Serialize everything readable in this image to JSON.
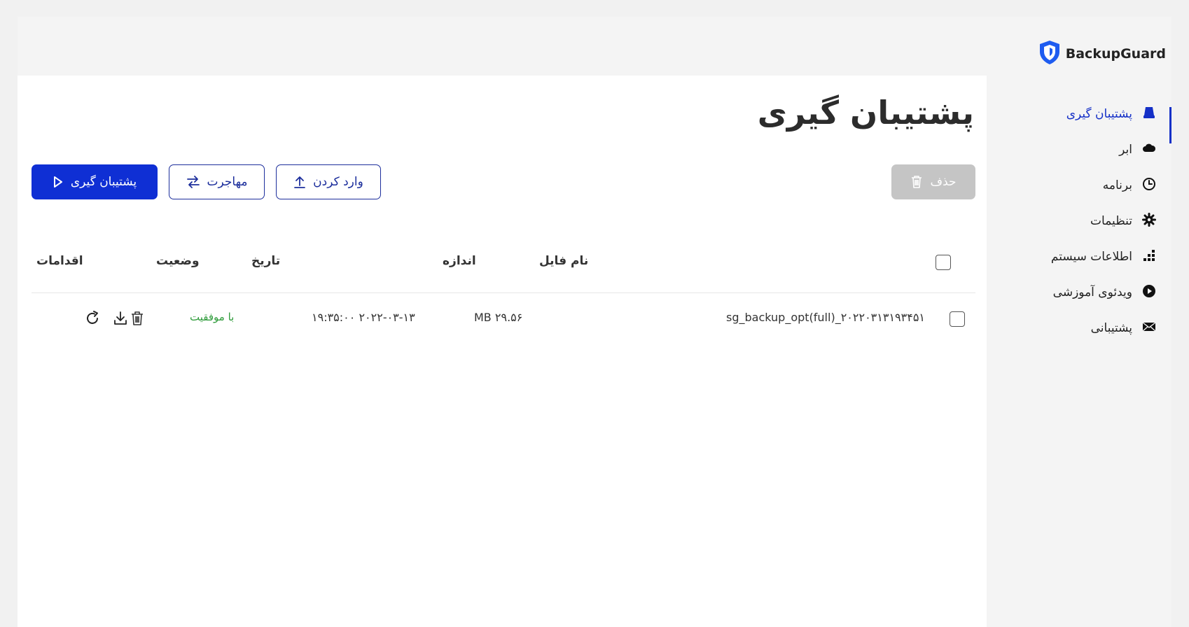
{
  "app": {
    "logo_text": "BackupGuard"
  },
  "page": {
    "title": "پشتیبان گیری"
  },
  "toolbar": {
    "backup_label": "پشتیبان گیری",
    "migrate_label": "مهاجرت",
    "import_label": "وارد کردن",
    "delete_label": "حذف"
  },
  "table": {
    "headers": {
      "filename": "نام فایل",
      "size": "اندازه",
      "date": "تاریخ",
      "status": "وضعیت",
      "actions": "اقدامات"
    },
    "rows": [
      {
        "filename": "sg_backup_opt(full)_۲۰۲۲۰۳۱۳۱۹۳۴۵۱",
        "size": "۲۹.۵۶ MB",
        "date": "۲۰۲۲-۰۳-۱۳ ۱۹:۳۵:۰۰",
        "status": "با موفقیت"
      }
    ]
  },
  "sidebar": {
    "items": [
      {
        "label": "پشتیبان گیری",
        "icon": "drive-icon",
        "active": true
      },
      {
        "label": "ابر",
        "icon": "cloud-icon"
      },
      {
        "label": "برنامه",
        "icon": "clock-icon"
      },
      {
        "label": "تنظیمات",
        "icon": "gear-icon"
      },
      {
        "label": "اطلاعات سیستم",
        "icon": "grid-chart-icon"
      },
      {
        "label": "ویدئوی آموزشی",
        "icon": "play-icon"
      },
      {
        "label": "پشتیبانی",
        "icon": "envelope-icon"
      }
    ]
  },
  "colors": {
    "accent": "#1530c7",
    "primary_button": "#0f2fd4",
    "success": "#2e9b3a",
    "disabled": "#c5c5c5"
  }
}
